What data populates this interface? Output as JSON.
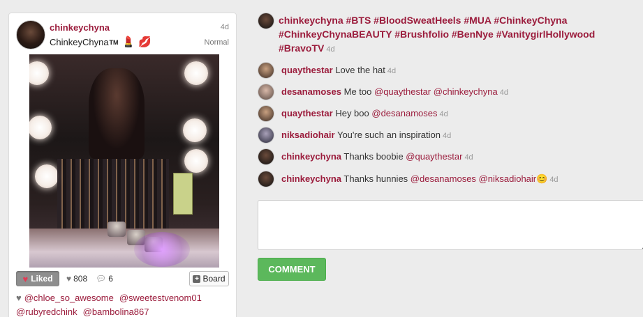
{
  "post": {
    "username": "chinkeychyna",
    "fullname": "ChinkeyChyna",
    "fullname_tm": "TM",
    "age": "4d",
    "filter": "Normal",
    "likes_count": "808",
    "comments_count": "6",
    "liked_label": "Liked",
    "board_label": "Board",
    "likers": [
      "@chloe_so_awesome",
      "@sweetestvenom01",
      "@rubyredchink",
      "@bambolina867"
    ]
  },
  "caption": {
    "text": "chinkeychyna #BTS #BloodSweatHeels #MUA #ChinkeyChyna #ChinkeyChynaBEAUTY #Brushfolio #BenNye #VanitygirlHollywood #BravoTV",
    "age": "4d"
  },
  "comments": [
    {
      "user": "quaythestar",
      "text": "Love the hat",
      "mentions": "",
      "age": "4d"
    },
    {
      "user": "desanamoses",
      "text": "Me too",
      "mentions": "@quaythestar @chinkeychyna",
      "age": "4d"
    },
    {
      "user": "quaythestar",
      "text": "Hey boo",
      "mentions": "@desanamoses",
      "age": "4d"
    },
    {
      "user": "niksadiohair",
      "text": "You're such an inspiration",
      "mentions": "",
      "age": "4d"
    },
    {
      "user": "chinkeychyna",
      "text": "Thanks boobie",
      "mentions": "@quaythestar",
      "age": "4d"
    },
    {
      "user": "chinkeychyna",
      "text": "Thanks hunnies",
      "mentions": "@desanamoses @niksadiohair",
      "age": "4d"
    }
  ],
  "comment_form": {
    "placeholder": "",
    "button_label": "COMMENT"
  },
  "colors": {
    "username": "#9b1c3c",
    "button_green": "#5cb85c",
    "liked_gray": "#8e8e8e",
    "heart_red": "#e23b55"
  }
}
